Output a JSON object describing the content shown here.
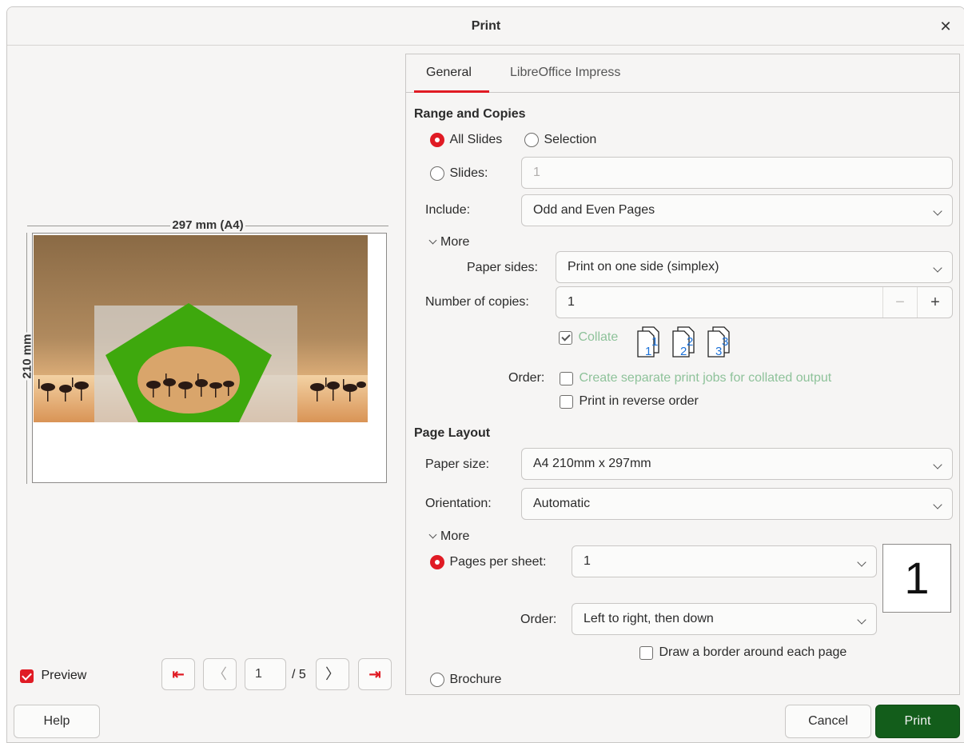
{
  "window": {
    "title": "Print"
  },
  "preview": {
    "width_label": "297 mm (A4)",
    "height_label": "210 mm",
    "preview_label": "Preview",
    "page_input": "1",
    "page_total": "/ 5"
  },
  "tabs": [
    "General",
    "LibreOffice Impress"
  ],
  "range": {
    "heading": "Range and Copies",
    "all_slides": "All Slides",
    "selection": "Selection",
    "slides": "Slides:",
    "slides_placeholder": "1",
    "include_label": "Include:",
    "include_value": "Odd and Even Pages",
    "more": "More",
    "paper_sides_label": "Paper sides:",
    "paper_sides_value": "Print on one side (simplex)",
    "copies_label": "Number of copies:",
    "copies_value": "1",
    "collate": "Collate",
    "order_label": "Order:",
    "separate_jobs": "Create separate print jobs for collated output",
    "reverse": "Print in reverse order"
  },
  "layout": {
    "heading": "Page Layout",
    "paper_size_label": "Paper size:",
    "paper_size_value": "A4 210mm x 297mm",
    "orientation_label": "Orientation:",
    "orientation_value": "Automatic",
    "more": "More",
    "pages_per_sheet_label": "Pages per sheet:",
    "pages_per_sheet_value": "1",
    "order_label": "Order:",
    "order_value": "Left to right, then down",
    "border": "Draw a border around each page",
    "brochure": "Brochure",
    "sheet_preview": "1"
  },
  "buttons": {
    "help": "Help",
    "cancel": "Cancel",
    "print": "Print"
  },
  "colors": {
    "accent": "#e01b24",
    "print_button": "#135d1b",
    "shape": "#3ea80d"
  }
}
